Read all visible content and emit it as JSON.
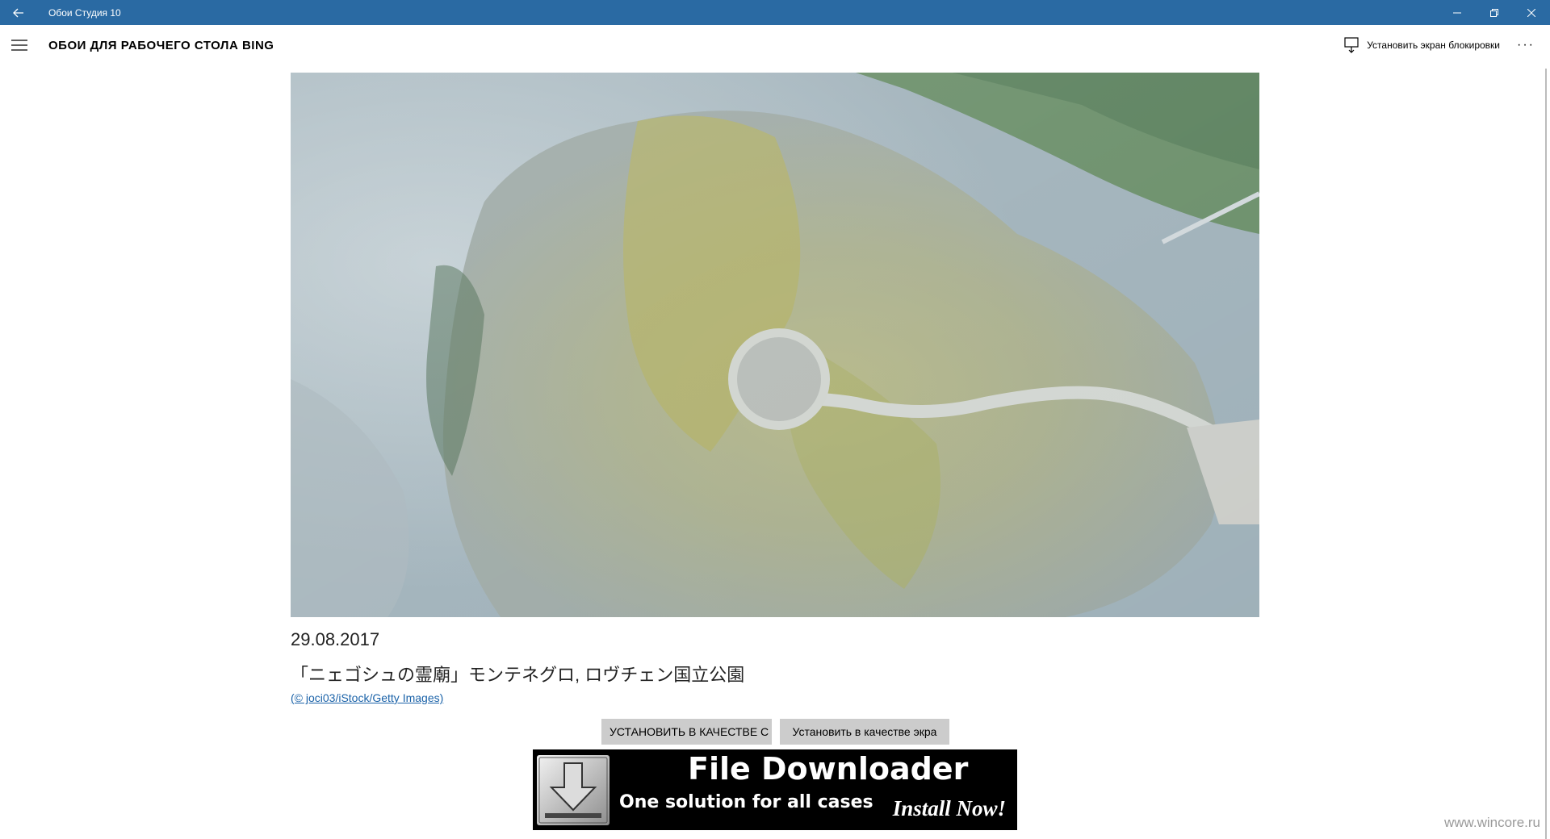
{
  "window": {
    "title": "Обои Студия 10"
  },
  "appbar": {
    "title": "ОБОИ ДЛЯ РАБОЧЕГО СТОЛА BING",
    "lock_screen_label": "Установить экран блокировки",
    "more_label": "···"
  },
  "wallpaper": {
    "date": "29.08.2017",
    "caption": "「ニェゴシュの霊廟」モンテネグロ, ロヴチェン国立公園",
    "credit": "(© joci03/iStock/Getty Images)"
  },
  "actions": {
    "set_desktop": "УСТАНОВИТЬ В КАЧЕСТВЕ С",
    "set_lock": "Установить в качестве экра"
  },
  "ad": {
    "title": "File Downloader",
    "subtitle": "One solution for all cases",
    "cta": "Install Now!"
  },
  "watermark": "www.wincore.ru",
  "colors": {
    "titlebar": "#2a6aa3",
    "link": "#1a62a8",
    "button": "#cccccc"
  }
}
